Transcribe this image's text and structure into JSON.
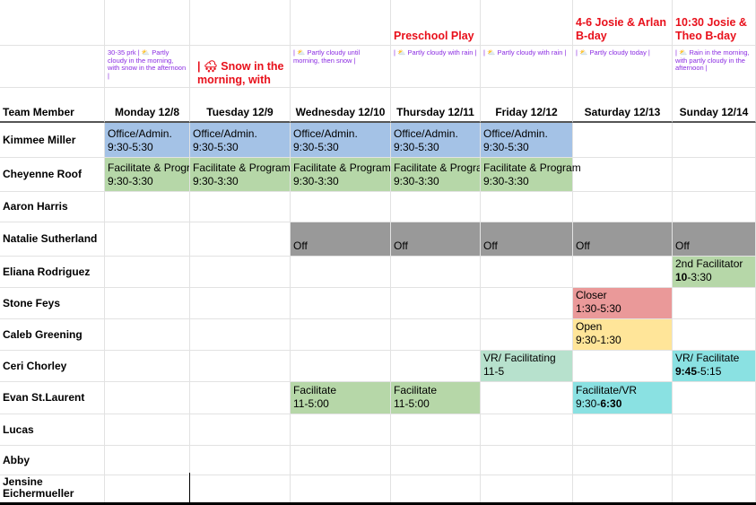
{
  "events": {
    "a": "",
    "mon": "",
    "tue": "",
    "wed": "",
    "thu": "Preschool Play",
    "fri": "",
    "sat": "4-6 Josie & Arlan B-day",
    "sun": "10:30 Josie & Theo B-day"
  },
  "weather": {
    "mon": "30-35 prk | ⛅ Partly cloudy in the morning, with snow in the afternoon |",
    "tue": "| 🌨 Snow in the morning, with",
    "wed": "| ⛅ Partly cloudy until morning, then snow |",
    "thu": "| ⛅ Partly cloudy with rain |",
    "fri": "| ⛅ Partly cloudy with rain |",
    "sat": "| ⛅ Partly cloudy today |",
    "sun": "| ⛅ Rain in the morning, with partly cloudy in the afternoon |"
  },
  "headers": {
    "team": "Team Member",
    "mon": "Monday 12/8",
    "tue": "Tuesday 12/9",
    "wed": "Wednesday 12/10",
    "thu": "Thursday 12/11",
    "fri": "Friday 12/12",
    "sat": "Saturday 12/13",
    "sun": "Sunday 12/14"
  },
  "members": [
    "Kimmee Miller",
    "Cheyenne Roof",
    "Aaron Harris",
    "Natalie Sutherland",
    "Eliana Rodriguez",
    "Stone Feys",
    "Caleb Greening",
    "Ceri Chorley",
    "Evan St.Laurent",
    "Lucas",
    "Abby",
    "Jensine Eichermueller"
  ],
  "shifts": {
    "office_role": "Office/Admin.",
    "office_time": "9:30-5:30",
    "facprog_role": "Facilitate & Program",
    "facprog_time": "9:30-3:30",
    "off": "Off",
    "second_fac_role": "2nd Facilitator",
    "second_fac_time_bold": "10",
    "second_fac_time_rest": "-3:30",
    "closer_role": "Closer",
    "closer_time": "1:30-5:30",
    "open_role": "Open",
    "open_time": "9:30-1:30",
    "vr_fri_role": "VR/ Facilitating",
    "vr_fri_time": "11-5",
    "vr_sun_role": "VR/ Facilitate",
    "vr_sun_time_bold": "9:45",
    "vr_sun_time_rest": "-5:15",
    "fac_role": "Facilitate",
    "fac_time": "11-5:00",
    "facvr_role": "Facilitate/VR",
    "facvr_time_start": "9:30-",
    "facvr_time_bold": "6:30"
  },
  "colors": {
    "office": "#a4c2e6",
    "facilitate": "#b6d7a8",
    "off": "#999999",
    "closer": "#ea9999",
    "open": "#ffe599",
    "vr": "#b7e1cd",
    "vr_sun": "#8ae1e2",
    "event_text": "#e8101b",
    "weather_text": "#8a2be2"
  }
}
